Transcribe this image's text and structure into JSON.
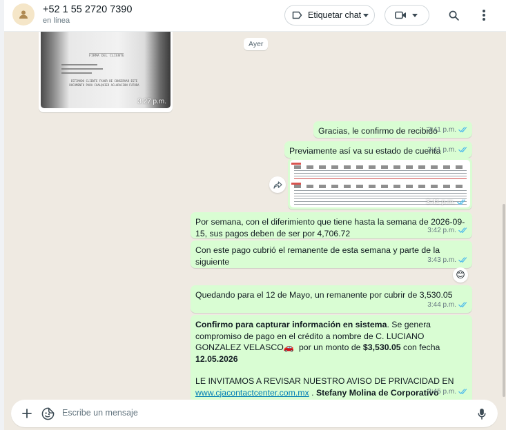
{
  "header": {
    "contact_name": "+52 1 55 2720 7390",
    "status": "en línea",
    "label_button": "Etiquetar chat",
    "icons": [
      "user-avatar-icon",
      "tag-icon",
      "video-call-icon",
      "search-icon",
      "more-vertical-icon"
    ]
  },
  "colors": {
    "outgoing_bubble": "#d9fdd3",
    "chat_background": "#efeae2",
    "read_ticks": "#53bdeb",
    "link": "#027eb5"
  },
  "chat": {
    "day_separator": "Ayer",
    "incoming_image": {
      "time": "3:27 p.m.",
      "receipt_heading": "FIRMA DEL CLIENTE",
      "receipt_footer": "ESTIMADO CLIENTE FAVOR DE CONSERVAR ESTE DOCUMENTO PARA CUALQUIER ACLARACION FUTURA"
    },
    "messages": [
      {
        "text": "Gracias, le confirmo de recibido",
        "time": "3:41 p.m."
      },
      {
        "text": "Previamente así va su estado de cuenta",
        "time": "3:41 p.m."
      },
      {
        "type": "image",
        "time": "3:41 p.m."
      },
      {
        "text": "Por semana, con el diferimiento que tiene hasta la semana de 2026-09-15, sus pagos deben de ser por 4,706.72",
        "time": "3:42 p.m."
      },
      {
        "text": "Con este pago cubrió el remanente de esta semana y parte de la siguiente",
        "time": "3:43 p.m.",
        "reaction": "😊"
      },
      {
        "text": "Quedando para el 12 de Mayo, un remanente por cubrir de 3,530.05",
        "time": "3:44 p.m."
      },
      {
        "time": "3:45 p.m.",
        "p1_bold": "Confirmo para capturar información en sistema",
        "p1_rest": ". Se genera compromiso de pago en el crédito a nombre de C. LUCIANO GONZALEZ VELASCO",
        "car_emoji": "🚗",
        "p1_mid": "  por un monto de ",
        "amount": "$3,530.05",
        "p1_date_label": " con fecha ",
        "date": "12.05.2026",
        "p2_start": "LE INVITAMOS A REVISAR NUESTRO AVISO DE PRIVACIDAD EN ",
        "link": "www.cjacontactcenter.com.mx",
        "p2_sep": " . ",
        "p2_bold": "Stefany Molina de Corporativo Jurídico en representación de SICREA"
      }
    ]
  },
  "composer": {
    "placeholder": "Escribe un mensaje",
    "icons": [
      "plus-icon",
      "sticker-icon",
      "microphone-icon"
    ]
  }
}
